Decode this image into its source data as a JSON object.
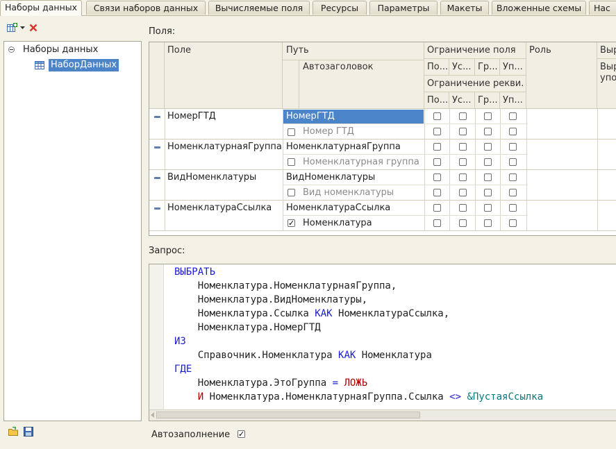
{
  "tabs": [
    {
      "label": "Наборы данных",
      "active": true
    },
    {
      "label": "Связи наборов данных"
    },
    {
      "label": "Вычисляемые поля"
    },
    {
      "label": "Ресурсы"
    },
    {
      "label": "Параметры"
    },
    {
      "label": "Макеты"
    },
    {
      "label": "Вложенные схемы"
    },
    {
      "label": "Нас"
    }
  ],
  "tree": {
    "root": "Наборы данных",
    "child": "НаборДанных"
  },
  "fields_label": "Поля:",
  "grid": {
    "headers": {
      "field": "Поле",
      "path": "Путь",
      "autotitle": "Автозаголовок",
      "restrict_field": "Ограничение поля",
      "restrict_attr": "Ограничение рекви...",
      "role": "Роль",
      "expr": "Выр",
      "expr2": "Выр",
      "expr3": "упо",
      "r1": [
        "По...",
        "Ус...",
        "Гр...",
        "Уп..."
      ],
      "r2": [
        "По...",
        "Ус...",
        "Гр...",
        "Уп..."
      ]
    },
    "rows": [
      {
        "field": "НомерГТД",
        "path": "НомерГТД",
        "title": "Номер ГТД",
        "title_checked": false
      },
      {
        "field": "НоменклатурнаяГруппа",
        "path": "НоменклатурнаяГруппа",
        "title": "Номенклатурная группа",
        "title_checked": false
      },
      {
        "field": "ВидНоменклатуры",
        "path": "ВидНоменклатуры",
        "title": "Вид номенклатуры",
        "title_checked": false
      },
      {
        "field": "НоменклатураСсылка",
        "path": "НоменклатураСсылка",
        "title": "Номенклатура",
        "title_checked": true
      }
    ]
  },
  "query_label": "Запрос:",
  "query": {
    "l1": "ВЫБРАТЬ",
    "l2": "    Номенклатура.НоменклатурнаяГруппа,",
    "l3": "    Номенклатура.ВидНоменклатуры,",
    "l4a": "    Номенклатура.Ссылка ",
    "l4kw": "КАК",
    "l4b": " НоменклатураСсылка,",
    "l5": "    Номенклатура.НомерГТД",
    "l6": "ИЗ",
    "l7a": "    Справочник.Номенклатура ",
    "l7kw": "КАК",
    "l7b": " Номенклатура",
    "l8": "ГДЕ",
    "l9a": "    Номенклатура.ЭтоГруппа ",
    "l9op": "=",
    "l9b": " ЛОЖЬ",
    "l10a": "    ",
    "l10and": "И",
    "l10b": " Номенклатура.НоменклатурнаяГруппа.Ссылка ",
    "l10op": "<>",
    "l10c": " &ПустаяСсылка"
  },
  "autofill_label": "Автозаполнение",
  "autofill_checked": true,
  "colors": {
    "selection": "#4b84c8",
    "keyword": "#1b1bd1",
    "literal": "#b00000",
    "parameter": "#007a7a",
    "delete": "#d23a2a"
  }
}
